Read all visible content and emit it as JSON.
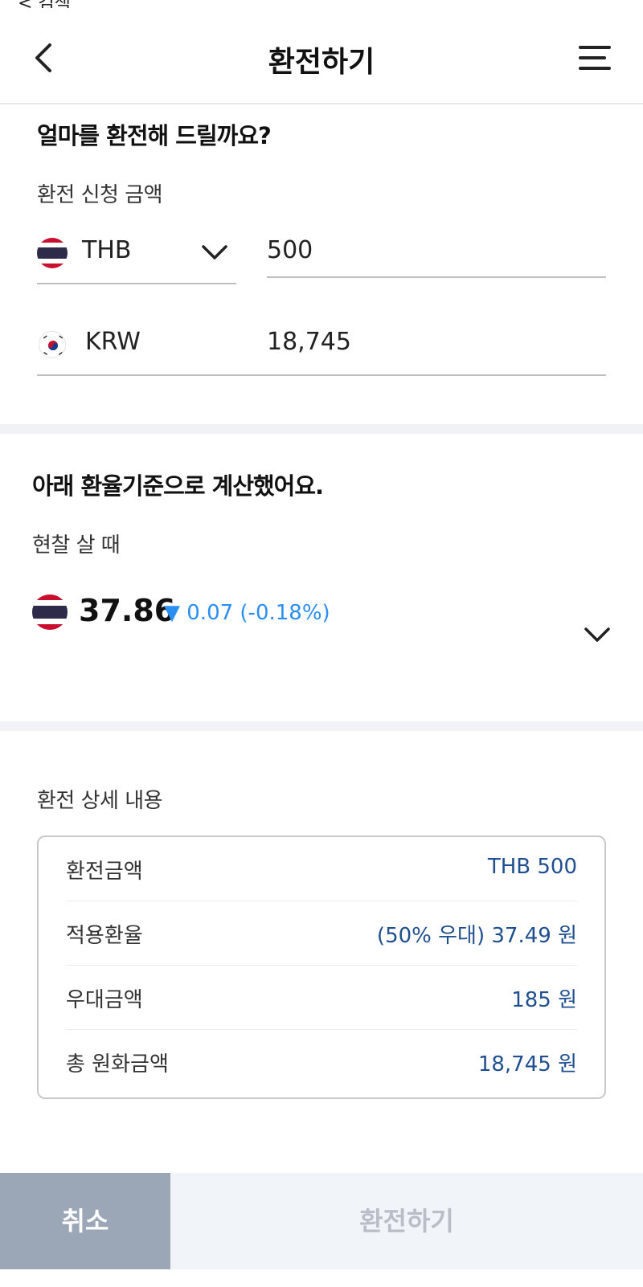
{
  "status": {
    "partial_text": "< 검색"
  },
  "header": {
    "title": "환전하기",
    "back_icon": "chevron-left-icon",
    "menu_icon": "hamburger-icon"
  },
  "amount_section": {
    "heading": "얼마를 환전해 드릴까요?",
    "label": "환전 신청 금액",
    "from_currency": "THB",
    "from_amount": "500",
    "to_currency": "KRW",
    "to_amount": "18,745"
  },
  "rate_section": {
    "heading": "아래 환율기준으로 계산했어요.",
    "rate_type": "현찰 살 때",
    "rate": "37.86",
    "change": "▼ 0.07 (-0.18%)",
    "change_color": "#2a8ff0"
  },
  "detail_section": {
    "label": "환전 상세 내용",
    "rows": [
      {
        "key": "환전금액",
        "value": "THB 500"
      },
      {
        "key": "적용환율",
        "value": "(50% 우대) 37.49 원"
      },
      {
        "key": "우대금액",
        "value": "185 원"
      },
      {
        "key": "총 원화금액",
        "value": "18,745 원"
      }
    ]
  },
  "buttons": {
    "cancel": "취소",
    "exchange": "환전하기"
  },
  "colors": {
    "value_blue": "#1f4f8f",
    "cancel_bg": "#9ba7b6",
    "exchange_bg": "#f1f4f9"
  }
}
